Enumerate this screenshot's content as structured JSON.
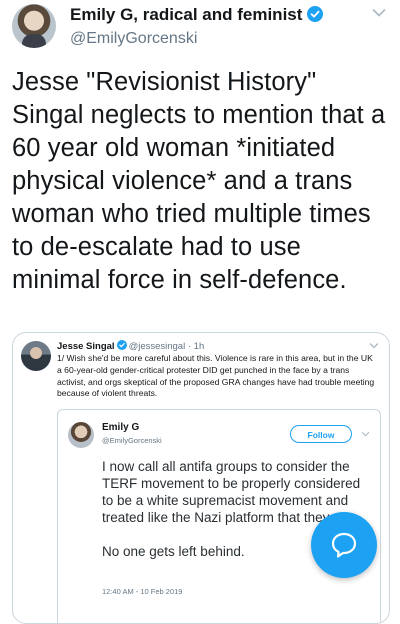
{
  "tweet": {
    "display_name": "Emily G, radical and feminist",
    "handle": "@EmilyGorcenski",
    "text": "Jesse \"Revisionist History\" Singal neglects to mention that a 60 year old woman *initiated physical violence* and a trans woman who tried multiple times to de-escalate had to use minimal force in self-defence."
  },
  "quoted": {
    "name": "Jesse Singal",
    "handle": "@jessesingal",
    "time": "· 1h",
    "text": "1/ Wish she'd be more careful about this. Violence is rare in this area, but in the UK a 60-year-old gender-critical protester DID get punched in the face by a trans activist, and orgs skeptical of the proposed GRA changes have had trouble meeting because of violent threats."
  },
  "embedded": {
    "name": "Emily G",
    "handle": "@EmilyGorcenski",
    "follow_label": "Follow",
    "paragraph1": "I now call all antifa groups to consider the TERF movement to be properly considered to be a white supremacist movement and treated like the Nazi platform that they are.",
    "paragraph2": "No one gets left behind.",
    "timestamp": "12:40 AM - 10 Feb 2019"
  },
  "colors": {
    "accent": "#1da1f2",
    "secondary_text": "#657786",
    "border": "#ccd6dd"
  },
  "icons": {
    "verified": "verified-badge-icon",
    "caret": "chevron-down-icon",
    "reply": "reply-bubble-icon"
  }
}
